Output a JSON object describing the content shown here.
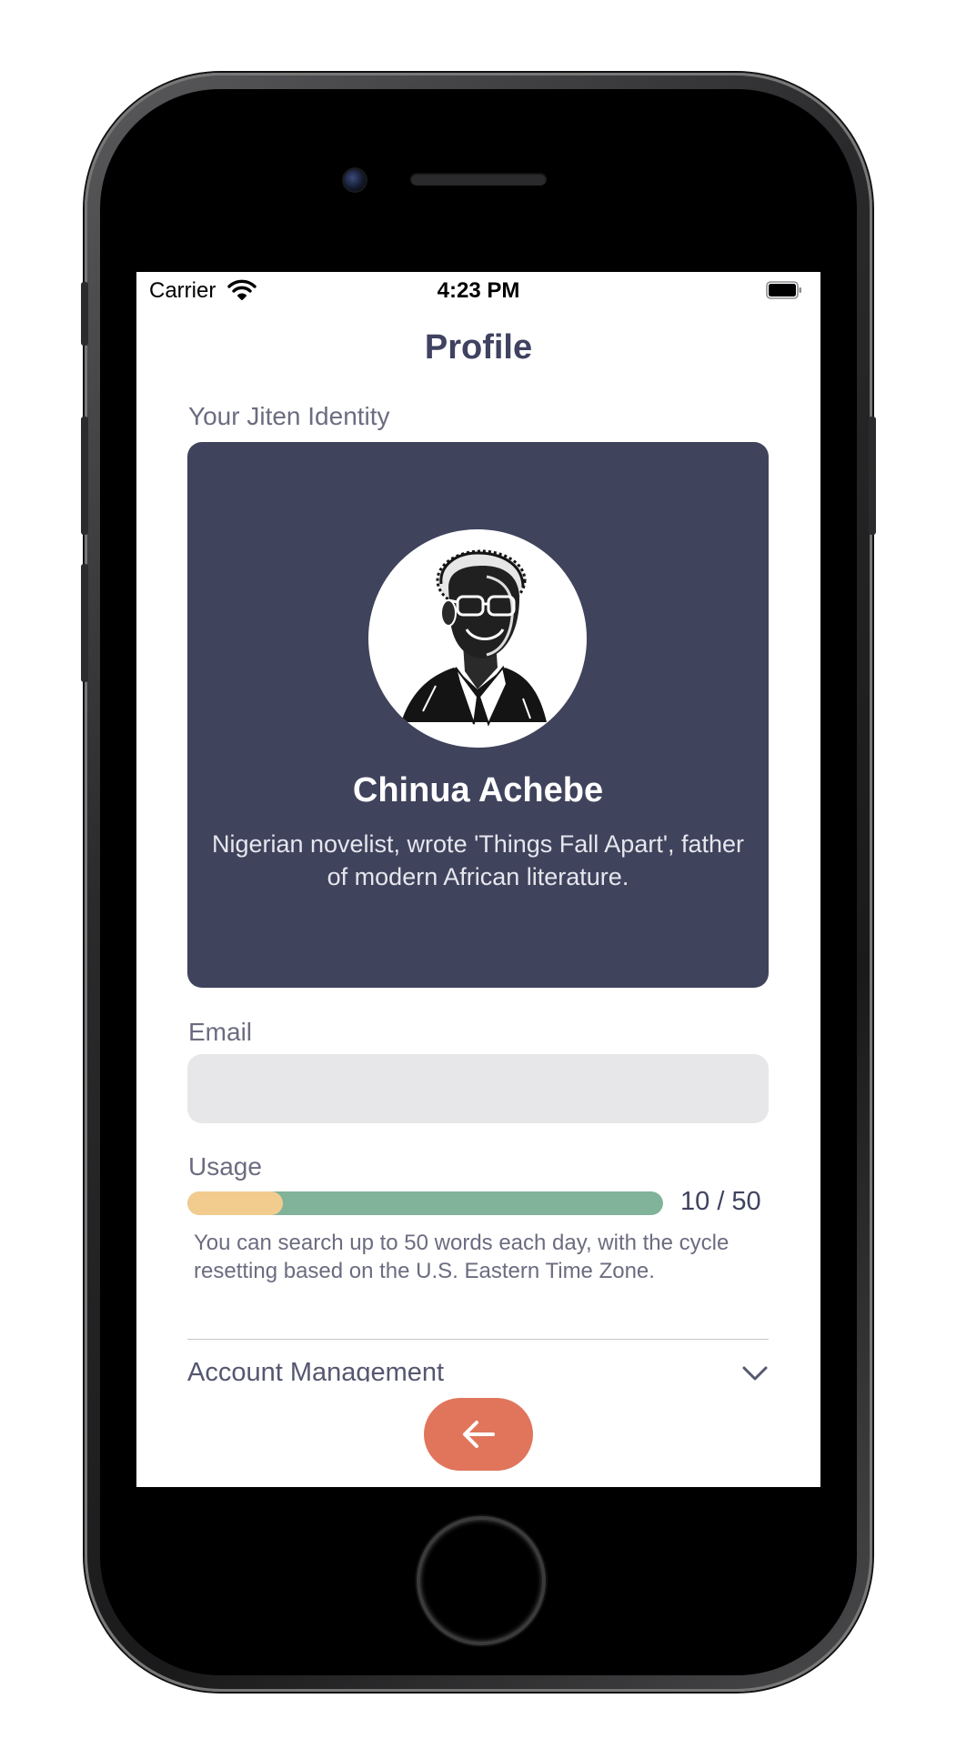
{
  "status_bar": {
    "carrier": "Carrier",
    "time": "4:23 PM"
  },
  "page": {
    "title": "Profile"
  },
  "identity": {
    "section_label": "Your Jiten Identity",
    "name": "Chinua Achebe",
    "description": "Nigerian novelist, wrote 'Things Fall Apart', father of modern African literature.",
    "card_color": "#40435c",
    "avatar_icon": "portrait-illustration"
  },
  "email": {
    "label": "Email",
    "value": ""
  },
  "usage": {
    "label": "Usage",
    "used": 10,
    "limit": 50,
    "count_text": "10 / 50",
    "note": "You can search up to 50 words each day, with the cycle resetting based on the U.S. Eastern Time Zone.",
    "used_color": "#f2cc8f",
    "remaining_color": "#81b29a"
  },
  "account": {
    "label": "Account Management",
    "icon": "chevron-down-icon"
  },
  "back_button": {
    "icon": "arrow-left-icon",
    "color": "#e0755b"
  }
}
